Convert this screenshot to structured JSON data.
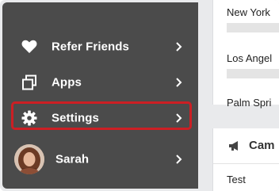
{
  "menu": {
    "items": [
      {
        "label": "Refer Friends",
        "icon": "heart-icon"
      },
      {
        "label": "Apps",
        "icon": "apps-icon"
      },
      {
        "label": "Settings",
        "icon": "gear-icon",
        "highlighted": true
      },
      {
        "label": "Sarah",
        "icon": "avatar"
      }
    ]
  },
  "content": {
    "cities": [
      "New York",
      "Los Angel",
      "Palm Spri"
    ],
    "card_title": "Cam",
    "card_item": "Test"
  },
  "colors": {
    "sidebar_bg": "#4b4b4b",
    "highlight_border": "#cc1f24",
    "text_white": "#ffffff"
  }
}
